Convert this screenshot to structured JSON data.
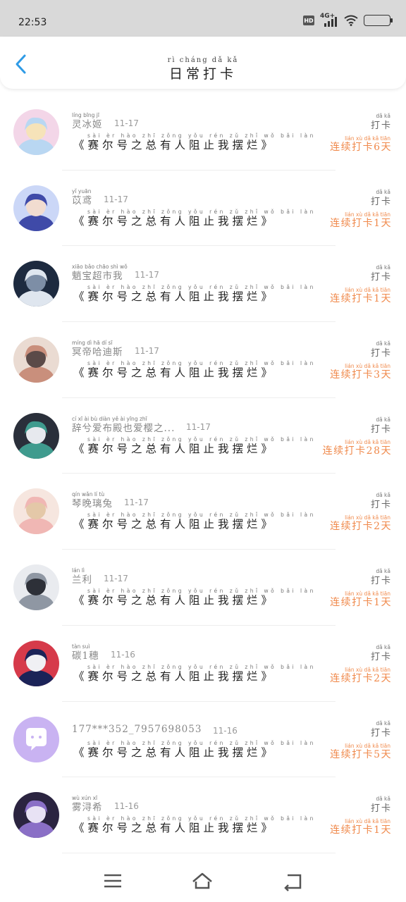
{
  "status": {
    "time": "22:53",
    "hd": "HD",
    "network": "4G+"
  },
  "header": {
    "title": "日常打卡",
    "title_pinyin": "rì cháng dǎ kǎ"
  },
  "checkin_label": "打卡",
  "checkin_pinyin": "dǎ kǎ",
  "items": [
    {
      "name": "灵冰姬",
      "name_pinyin": "líng bīng jī",
      "date": "11-17",
      "title": "《赛尔号之总有人阻止我摆烂》",
      "title_pinyin": "sài èr hào zhī zǒng yǒu rén zǔ zhǐ wǒ bǎi làn",
      "streak": "连续打卡6天",
      "streak_pinyin": "lián xù dǎ kǎ tiān",
      "avatar_colors": [
        "#f3d6e8",
        "#b9d7f2",
        "#f6e3b9"
      ]
    },
    {
      "name": "苡鸢",
      "name_pinyin": "yǐ yuān",
      "date": "11-17",
      "title": "《赛尔号之总有人阻止我摆烂》",
      "title_pinyin": "sài èr hào zhī zǒng yǒu rén zǔ zhǐ wǒ bǎi làn",
      "streak": "连续打卡1天",
      "streak_pinyin": "lián xù dǎ kǎ tiān",
      "avatar_colors": [
        "#cbd7f7",
        "#3f4aa8",
        "#f1dcd0"
      ]
    },
    {
      "name": "魈宝超市我",
      "name_pinyin": "xiāo bǎo chāo shì wǒ",
      "date": "11-17",
      "title": "《赛尔号之总有人阻止我摆烂》",
      "title_pinyin": "sài èr hào zhī zǒng yǒu rén zǔ zhǐ wǒ bǎi làn",
      "streak": "连续打卡1天",
      "streak_pinyin": "lián xù dǎ kǎ tiān",
      "avatar_colors": [
        "#1d2a3f",
        "#dfe6ef",
        "#7d8ea6"
      ]
    },
    {
      "name": "冥帝哈迪斯",
      "name_pinyin": "míng dì hā dí sī",
      "date": "11-17",
      "title": "《赛尔号之总有人阻止我摆烂》",
      "title_pinyin": "sài èr hào zhī zǒng yǒu rén zǔ zhǐ wǒ bǎi làn",
      "streak": "连续打卡3天",
      "streak_pinyin": "lián xù dǎ kǎ tiān",
      "avatar_colors": [
        "#eadbd2",
        "#c98f7c",
        "#5b4a48"
      ]
    },
    {
      "name": "辞兮爱布殿也爱樱之...",
      "name_pinyin": "cí xī ài bù diàn yě ài yīng zhī",
      "date": "11-17",
      "title": "《赛尔号之总有人阻止我摆烂》",
      "title_pinyin": "sài èr hào zhī zǒng yǒu rén zǔ zhǐ wǒ bǎi làn",
      "streak": "连续打卡28天",
      "streak_pinyin": "lián xù dǎ kǎ tiān",
      "avatar_colors": [
        "#2a2f3a",
        "#3f9b8e",
        "#e7e9ee"
      ]
    },
    {
      "name": "琴晚璃兔",
      "name_pinyin": "qín wǎn lí tù",
      "date": "11-17",
      "title": "《赛尔号之总有人阻止我摆烂》",
      "title_pinyin": "sài èr hào zhī zǒng yǒu rén zǔ zhǐ wǒ bǎi làn",
      "streak": "连续打卡2天",
      "streak_pinyin": "lián xù dǎ kǎ tiān",
      "avatar_colors": [
        "#f6e6df",
        "#f0b7b4",
        "#e4c8a8"
      ]
    },
    {
      "name": "兰利",
      "name_pinyin": "lán lì",
      "date": "11-17",
      "title": "《赛尔号之总有人阻止我摆烂》",
      "title_pinyin": "sài èr hào zhī zǒng yǒu rén zǔ zhǐ wǒ bǎi làn",
      "streak": "连续打卡1天",
      "streak_pinyin": "lián xù dǎ kǎ tiān",
      "avatar_colors": [
        "#e9ebef",
        "#8f97a3",
        "#2d3038"
      ]
    },
    {
      "name": "碳1穗",
      "name_pinyin": "tàn suì",
      "date": "11-16",
      "title": "《赛尔号之总有人阻止我摆烂》",
      "title_pinyin": "sài èr hào zhī zǒng yǒu rén zǔ zhǐ wǒ bǎi làn",
      "streak": "连续打卡2天",
      "streak_pinyin": "lián xù dǎ kǎ tiān",
      "avatar_colors": [
        "#d63a4a",
        "#1b2358",
        "#f0f0f4"
      ]
    },
    {
      "name": "177***352_7957698053",
      "name_pinyin": "",
      "date": "11-16",
      "title": "《赛尔号之总有人阻止我摆烂》",
      "title_pinyin": "sài èr hào zhī zǒng yǒu rén zǔ zhǐ wǒ bǎi làn",
      "streak": "连续打卡5天",
      "streak_pinyin": "lián xù dǎ kǎ tiān",
      "avatar_colors": [
        "#c9b3f2",
        "#c9b3f2",
        "#ffffff"
      ]
    },
    {
      "name": "雾浔希",
      "name_pinyin": "wù xún xī",
      "date": "11-16",
      "title": "《赛尔号之总有人阻止我摆烂》",
      "title_pinyin": "sài èr hào zhī zǒng yǒu rén zǔ zhǐ wǒ bǎi làn",
      "streak": "连续打卡1天",
      "streak_pinyin": "lián xù dǎ kǎ tiān",
      "avatar_colors": [
        "#2b2440",
        "#8a6fc6",
        "#e8e2f4"
      ]
    }
  ],
  "colors": {
    "accent": "#2f9be6",
    "streak": "#f0894b",
    "status_bar": "#d9d9d9"
  },
  "icons": {
    "back": "chevron-left-icon",
    "menu": "menu-icon",
    "home": "home-icon",
    "nav_back": "return-icon"
  }
}
